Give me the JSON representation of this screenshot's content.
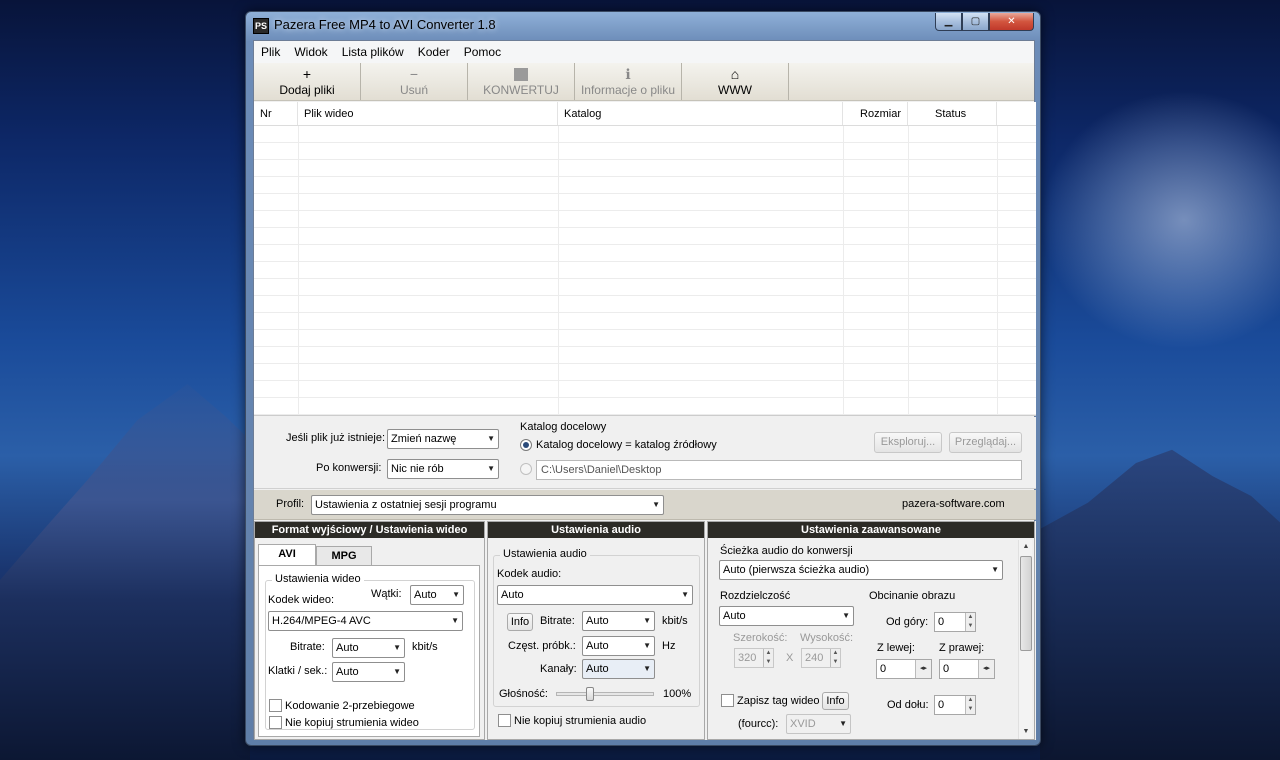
{
  "window": {
    "title": "Pazera Free MP4 to AVI Converter 1.8",
    "icon_text": "PS"
  },
  "menu": [
    "Plik",
    "Widok",
    "Lista plików",
    "Koder",
    "Pomoc"
  ],
  "toolbar": {
    "add": "Dodaj pliki",
    "remove": "Usuń",
    "convert": "KONWERTUJ",
    "info": "Informacje o pliku",
    "www": "WWW"
  },
  "file_list": {
    "columns": [
      "Nr",
      "Plik wideo",
      "Katalog",
      "Rozmiar",
      "Status"
    ]
  },
  "options": {
    "if_exists_label": "Jeśli plik już istnieje:",
    "if_exists_value": "Zmień nazwę",
    "after_label": "Po konwersji:",
    "after_value": "Nic nie rób",
    "dest_group": "Katalog docelowy",
    "dest_same": "Katalog docelowy = katalog źródłowy",
    "dest_path": "C:\\Users\\Daniel\\Desktop",
    "explore_btn": "Eksploruj...",
    "browse_btn": "Przeglądaj..."
  },
  "profile": {
    "label": "Profil:",
    "value": "Ustawienia z ostatniej sesji programu",
    "site": "pazera-software.com"
  },
  "video_panel": {
    "title": "Format wyjściowy / Ustawienia wideo",
    "tabs": [
      "AVI",
      "MPG"
    ],
    "group": "Ustawienia wideo",
    "threads_label": "Wątki:",
    "threads_value": "Auto",
    "codec_label": "Kodek wideo:",
    "codec_value": "H.264/MPEG-4 AVC",
    "bitrate_label": "Bitrate:",
    "bitrate_value": "Auto",
    "bitrate_unit": "kbit/s",
    "fps_label": "Klatki / sek.:",
    "fps_value": "Auto",
    "two_pass": "Kodowanie 2-przebiegowe",
    "no_copy": "Nie kopiuj strumienia wideo"
  },
  "audio_panel": {
    "title": "Ustawienia audio",
    "group": "Ustawienia audio",
    "codec_label": "Kodek audio:",
    "codec_value": "Auto",
    "info_btn": "Info",
    "bitrate_label": "Bitrate:",
    "bitrate_value": "Auto",
    "bitrate_unit": "kbit/s",
    "sample_label": "Częst. próbk.:",
    "sample_value": "Auto",
    "sample_unit": "Hz",
    "channels_label": "Kanały:",
    "channels_value": "Auto",
    "volume_label": "Głośność:",
    "volume_value": "100%",
    "volume_level": 0.33,
    "no_copy": "Nie kopiuj strumienia audio"
  },
  "adv_panel": {
    "title": "Ustawienia zaawansowane",
    "track_label": "Ścieżka audio do konwersji",
    "track_value": "Auto (pierwsza ścieżka audio)",
    "res_group": "Rozdzielczość",
    "res_value": "Auto",
    "width_label": "Szerokość:",
    "width_value": "320",
    "height_label": "Wysokość:",
    "height_value": "240",
    "x": "X",
    "crop_group": "Obcinanie obrazu",
    "top_label": "Od góry:",
    "top_value": "0",
    "left_label": "Z lewej:",
    "left_value": "0",
    "right_label": "Z prawej:",
    "right_value": "0",
    "bottom_label": "Od dołu:",
    "bottom_value": "0",
    "tag_label": "Zapisz tag wideo",
    "tag_info": "Info",
    "fourcc_label": "(fourcc):",
    "fourcc_value": "XVID"
  }
}
